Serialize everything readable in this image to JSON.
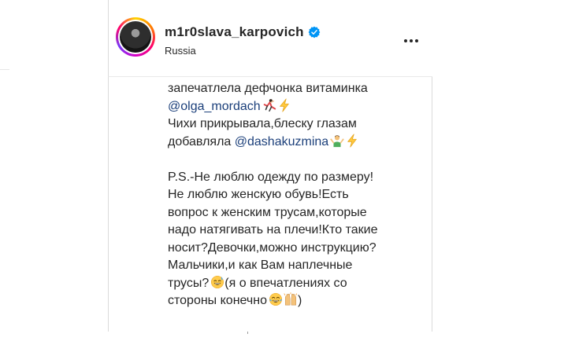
{
  "post": {
    "username": "m1r0slava_karpovich",
    "location": "Russia",
    "verified": true
  },
  "caption": {
    "line1": "запечатлела дефчонка витаминка",
    "mention1": "@olga_mordach",
    "line3": "Чихи прикрывала,блеску глазам",
    "line4_prefix": "добавляла ",
    "mention2": "@dashakuzmina",
    "line5": "P.S.-Не люблю одежду по размеру!",
    "line6": "Не люблю женскую обувь!Есть",
    "line7": "вопрос к женским трусам,которые",
    "line8": "надо натягивать на плечи!Кто такие",
    "line9": "носит?Девочки,можно инструкцию?",
    "line10": "Мальчики,и как Вам наплечные",
    "line11_prefix": "трусы?",
    "line11_suffix": "(я о впечатлениях со",
    "line12_prefix": "стороны конечно",
    "line12_suffix": ")"
  },
  "icons": {
    "verified": "verified-badge-icon",
    "more": "more-options-icon",
    "emoji_1": "dancer-emoji",
    "emoji_2": "high-voltage-emoji",
    "emoji_3": "person-shrugging-emoji",
    "emoji_4": "high-voltage-emoji",
    "emoji_5": "grinning-sweat-emoji",
    "emoji_6": "tears-of-joy-emoji",
    "emoji_7": "raising-hands-emoji"
  },
  "colors": {
    "text": "#262626",
    "mention": "#1b3f7a",
    "verified": "#0095f6",
    "border": "#dbdbdb"
  }
}
